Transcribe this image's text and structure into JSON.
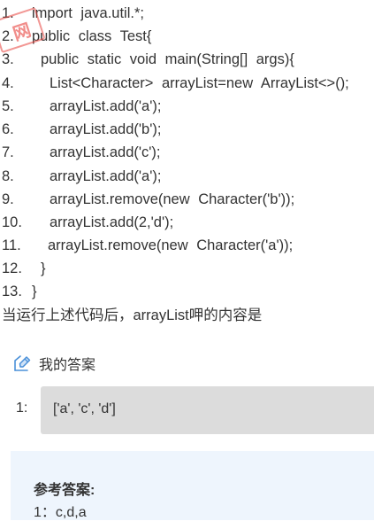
{
  "code_lines": [
    {
      "num": "1.",
      "text": "import java.util.*;"
    },
    {
      "num": "2.",
      "text": "public class Test{"
    },
    {
      "num": "3.",
      "text": "public static void main(String[] args){"
    },
    {
      "num": "4.",
      "text": "List<Character> arrayList=new ArrayList<>();"
    },
    {
      "num": "5.",
      "text": "arrayList.add('a');"
    },
    {
      "num": "6.",
      "text": "arrayList.add('b');"
    },
    {
      "num": "7.",
      "text": "arrayList.add('c');"
    },
    {
      "num": "8.",
      "text": "arrayList.add('a');"
    },
    {
      "num": "9.",
      "text": "arrayList.remove(new Character('b'));"
    },
    {
      "num": "10.",
      "text": "arrayList.add(2,'d');"
    },
    {
      "num": "11.",
      "text": "arrayList.remove(new Character('a'));"
    },
    {
      "num": "12.",
      "text": "}"
    },
    {
      "num": "13.",
      "text": "}"
    }
  ],
  "question": "当运行上述代码后，arrayList呷的内容是",
  "watermark": "网",
  "my_answer": {
    "title": "我的答案",
    "icon": "edit-pencil-icon",
    "index": "1:",
    "value": "['a', 'c', 'd']"
  },
  "reference": {
    "title": "参考答案:",
    "answer": "1：c,d,a"
  },
  "colors": {
    "answer_box_bg": "#dcdcdc",
    "reference_bg": "#eef5fd",
    "icon_blue": "#4a90d9",
    "stamp_red": "#e8413c"
  }
}
